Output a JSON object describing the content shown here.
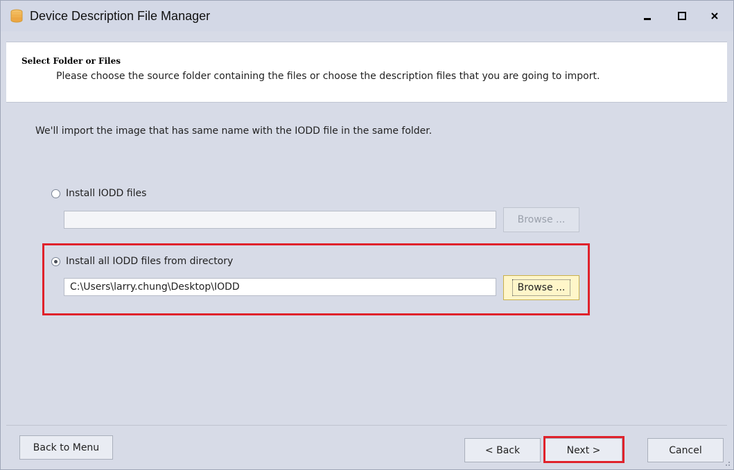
{
  "window": {
    "title": "Device Description File Manager",
    "icon": "database-icon",
    "controls": [
      "minimize-icon",
      "maximize-icon",
      "close-icon"
    ]
  },
  "header": {
    "title": "Select Folder or Files",
    "subtitle": "Please choose the source folder containing the files or choose the description files that you are going to import."
  },
  "info_text": "We'll import the image that has same name with the IODD file in the same folder.",
  "options": {
    "install_files": {
      "label": "Install IODD files",
      "selected": false,
      "path": "",
      "browse_label": "Browse ..."
    },
    "install_directory": {
      "label": "Install all IODD files from directory",
      "selected": true,
      "path": "C:\\Users\\larry.chung\\Desktop\\IODD",
      "browse_label": "Browse ..."
    }
  },
  "footer": {
    "back_to_menu": "Back to Menu",
    "back": "< Back",
    "next": "Next >",
    "cancel": "Cancel"
  },
  "colors": {
    "highlight": "#e0222b",
    "focused_button": "#fff6c9",
    "window_bg": "#d7dbe7"
  }
}
